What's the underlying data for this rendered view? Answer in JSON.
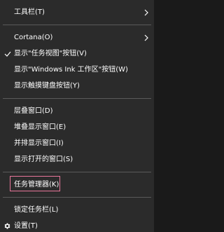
{
  "menu": {
    "items": [
      {
        "label": "工具栏(T)",
        "submenu": true
      },
      {
        "label": "Cortana(O)",
        "submenu": true
      },
      {
        "label": "显示\"任务视图\"按钮(V)",
        "checked": true
      },
      {
        "label": "显示\"Windows Ink 工作区\"按钮(W)"
      },
      {
        "label": "显示触摸键盘按钮(Y)"
      },
      {
        "label": "层叠窗口(D)"
      },
      {
        "label": "堆叠显示窗口(E)"
      },
      {
        "label": "并排显示窗口(I)"
      },
      {
        "label": "显示打开的窗口(S)"
      },
      {
        "label": "任务管理器(K)",
        "highlighted": true
      },
      {
        "label": "锁定任务栏(L)"
      },
      {
        "label": "设置(T)",
        "icon": "gear-icon"
      }
    ]
  },
  "colors": {
    "background": "#2b2b2b",
    "text": "#ffffff",
    "separator": "#5a5a5a",
    "highlight": "#e8769a"
  }
}
